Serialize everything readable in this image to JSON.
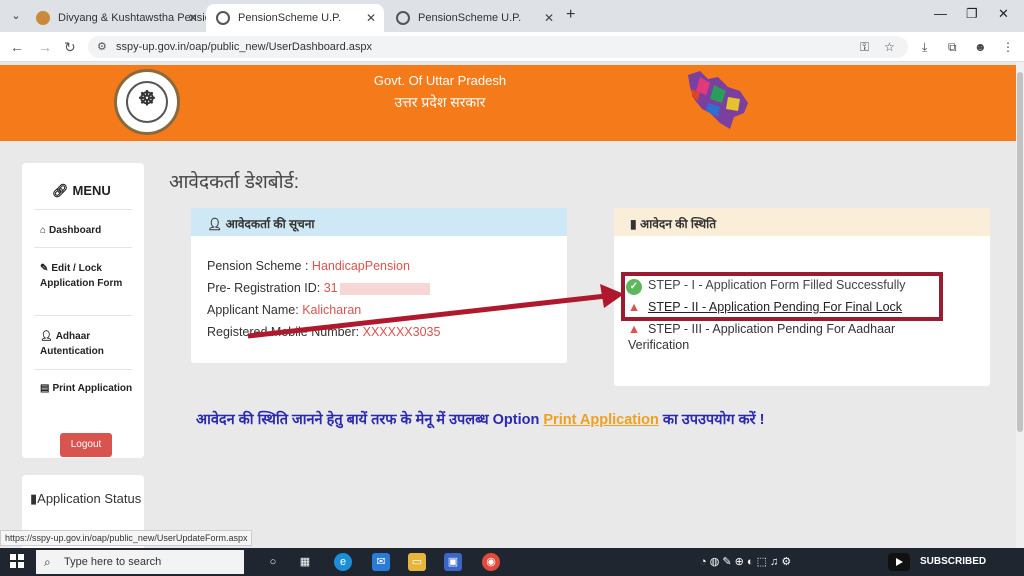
{
  "browser": {
    "tabs": [
      {
        "title": "Divyang & Kushtawstha Pensio",
        "active": false
      },
      {
        "title": "PensionScheme U.P.",
        "active": true
      },
      {
        "title": "PensionScheme U.P.",
        "active": false
      }
    ],
    "new_tab_label": "+",
    "url": "sspy-up.gov.in/oap/public_new/UserDashboard.aspx",
    "status_url": "https://sspy-up.gov.in/oap/public_new/UserUpdateForm.aspx"
  },
  "header": {
    "title": "Govt. Of Uttar Pradesh",
    "subtitle": "उत्तर प्रदेश सरकार"
  },
  "sidebar": {
    "menu_title": "MENU",
    "items": [
      {
        "label": "Dashboard",
        "icon": "home-icon"
      },
      {
        "label": "Edit / Lock Application Form",
        "icon": "edit-icon"
      },
      {
        "label": "Adhaar Autentication",
        "icon": "user-icon"
      },
      {
        "label": "Print Application",
        "icon": "file-icon"
      }
    ],
    "logout_label": "Logout"
  },
  "status_card": {
    "label": "Application Status"
  },
  "main": {
    "title": "आवेदकर्ता डेशबोर्ड:",
    "applicant_panel": {
      "heading": "आवेदकर्ता की सूचना",
      "rows": [
        {
          "label": "Pension Scheme : ",
          "value": "HandicapPension"
        },
        {
          "label": "Pre- Registration ID: ",
          "value": "31"
        },
        {
          "label": "Applicant Name: ",
          "value": "Kalicharan"
        },
        {
          "label": "Registered Mobile Number: ",
          "value": "XXXXXX3035"
        }
      ]
    },
    "status_panel": {
      "heading": "आवेदन की स्थिति",
      "steps": [
        "STEP - I - Application Form Filled Successfully",
        "STEP - II - Application Pending For Final Lock",
        "STEP - III - Application Pending For Aadhaar",
        "Verification"
      ]
    },
    "notice": {
      "text_before": "आवेदन की स्थिति जानने हेतु बायें तरफ के मेनू में उपलब्ध Option ",
      "link": "Print Application",
      "text_after": " का उपउपयोग करें !"
    }
  },
  "taskbar": {
    "search_placeholder": "Type here to search",
    "subscribed_label": "SUBSCRIBED"
  },
  "colors": {
    "header_orange": "#f47a1a",
    "highlight_box": "#9b1b30",
    "annotation_arrow": "#b0182e",
    "value_red": "#d9534f",
    "notice_blue": "#2a2ab0",
    "link_orange": "#f0a020"
  }
}
